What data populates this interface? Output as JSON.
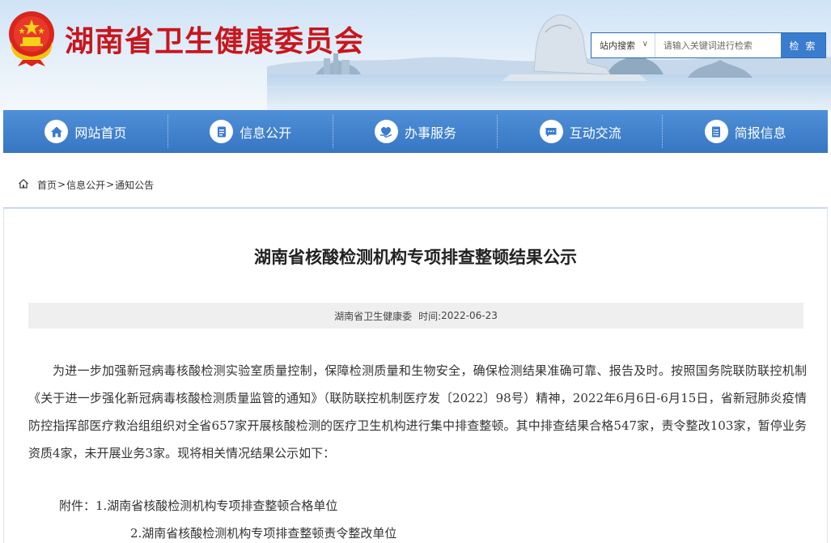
{
  "header": {
    "site_title": "湖南省卫生健康委员会",
    "search": {
      "scope": "站内搜索",
      "placeholder": "请输入关键词进行检索",
      "button": "检 索"
    }
  },
  "nav": {
    "items": [
      {
        "label": "网站首页",
        "icon": "home-icon"
      },
      {
        "label": "信息公开",
        "icon": "document-icon"
      },
      {
        "label": "办事服务",
        "icon": "heart-hand-icon"
      },
      {
        "label": "互动交流",
        "icon": "chat-icon"
      },
      {
        "label": "简报信息",
        "icon": "bulletin-icon"
      }
    ]
  },
  "breadcrumb": {
    "items": [
      "首页",
      "信息公开",
      "通知公告"
    ],
    "separator": ">"
  },
  "article": {
    "title": "湖南省核酸检测机构专项排查整顿结果公示",
    "source": "湖南省卫生健康委",
    "time_label": "时间:",
    "date": "2022-06-23",
    "body": "为进一步加强新冠病毒核酸检测实验室质量控制，保障检测质量和生物安全，确保检测结果准确可靠、报告及时。按照国务院联防联控机制《关于进一步强化新冠病毒核酸检测质量监管的通知》（联防联控机制医疗发〔2022〕98号）精神，2022年6月6日-6月15日，省新冠肺炎疫情防控指挥部医疗救治组组织对全省657家开展核酸检测的医疗卫生机构进行集中排查整顿。其中排查结果合格547家，责令整改103家，暂停业务资质4家，未开展业务3家。现将相关情况结果公示如下：",
    "attachments": [
      "附件：1.湖南省核酸检测机构专项排查整顿合格单位",
      "2.湖南省核酸检测机构专项排查整顿责令整改单位"
    ]
  },
  "colors": {
    "brand_red": "#c8161d",
    "nav_blue": "#3a7ccd",
    "meta_bg": "#efefef"
  }
}
